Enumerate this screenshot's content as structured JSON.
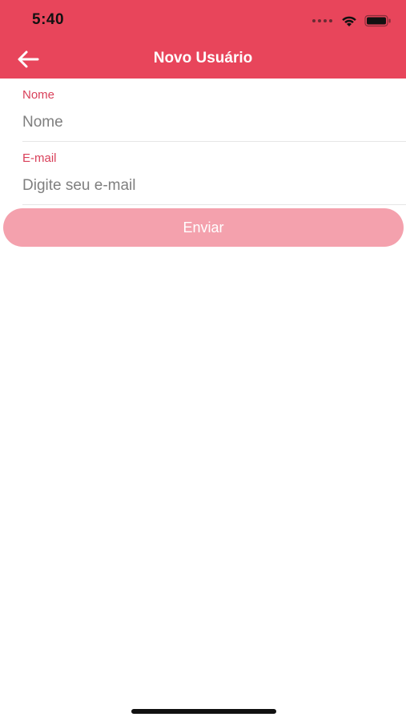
{
  "status_bar": {
    "time": "5:40",
    "icons": [
      "signal-dots-icon",
      "wifi-icon",
      "battery-icon"
    ]
  },
  "nav": {
    "back_icon": "arrow-left-icon",
    "title": "Novo Usuário"
  },
  "form": {
    "name_field": {
      "label": "Nome",
      "placeholder": "Nome",
      "value": ""
    },
    "email_field": {
      "label": "E-mail",
      "placeholder": "Digite seu e-mail",
      "value": ""
    },
    "submit_label": "Enviar"
  },
  "colors": {
    "header_bg": "#E8455B",
    "label": "#D9405A",
    "button_bg": "#F4A1AD"
  }
}
